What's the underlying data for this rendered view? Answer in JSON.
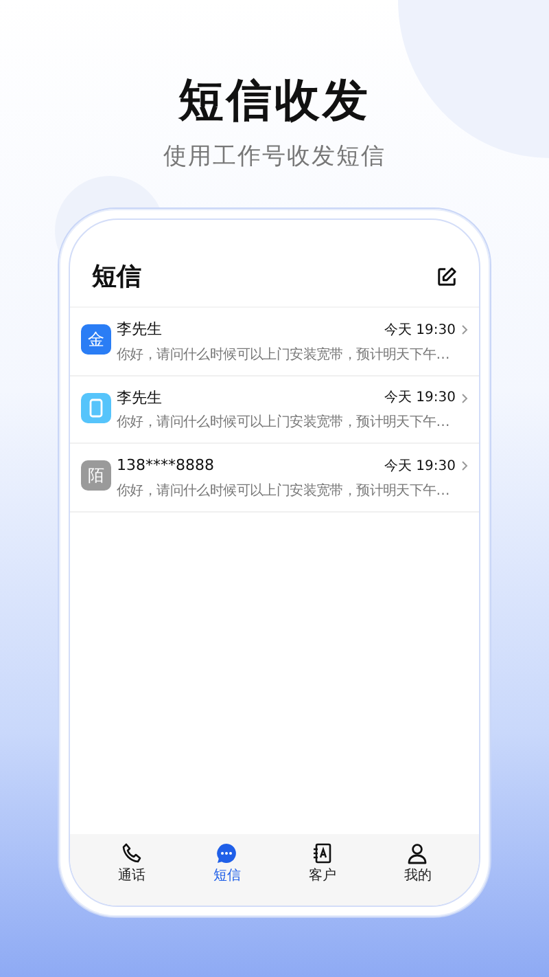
{
  "headline": "短信收发",
  "subheadline": "使用工作号收发短信",
  "screen": {
    "title": "短信",
    "messages": [
      {
        "avatar": {
          "kind": "text",
          "text": "金",
          "color": "#2a7df5"
        },
        "name": "李先生",
        "time": "今天 19:30",
        "preview": "你好，请问什么时候可以上门安装宽带，预计明天下午…"
      },
      {
        "avatar": {
          "kind": "phone",
          "color": "#56c4fb"
        },
        "name": "李先生",
        "time": "今天 19:30",
        "preview": "你好，请问什么时候可以上门安装宽带，预计明天下午…"
      },
      {
        "avatar": {
          "kind": "text",
          "text": "陌",
          "color": "#9a9a9a"
        },
        "name": "138****8888",
        "time": "今天 19:30",
        "preview": "你好，请问什么时候可以上门安装宽带，预计明天下午…"
      }
    ],
    "tabs": [
      {
        "kind": "phone",
        "label": "通话",
        "selected": false
      },
      {
        "kind": "chat",
        "label": "短信",
        "selected": true
      },
      {
        "kind": "contacts",
        "label": "客户",
        "selected": false
      },
      {
        "kind": "person",
        "label": "我的",
        "selected": false
      }
    ]
  }
}
